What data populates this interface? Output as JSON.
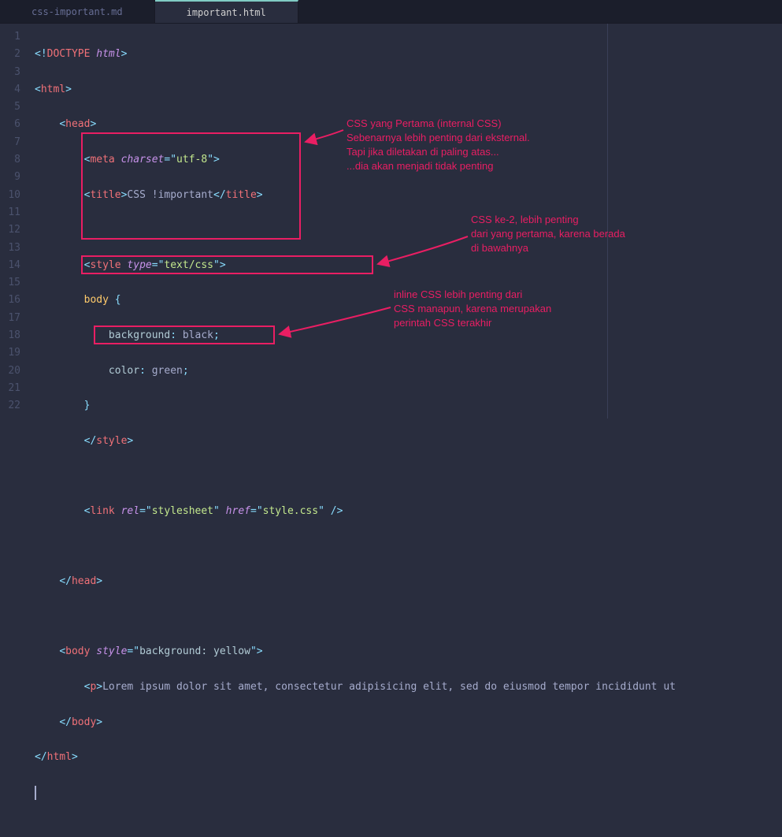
{
  "tabs": [
    {
      "label": "css-important.md",
      "active": false
    },
    {
      "label": "important.html",
      "active": true
    }
  ],
  "gutter": [
    "1",
    "2",
    "3",
    "4",
    "5",
    "6",
    "7",
    "8",
    "9",
    "10",
    "11",
    "12",
    "13",
    "14",
    "15",
    "16",
    "17",
    "18",
    "19",
    "20",
    "21",
    "22"
  ],
  "code": {
    "doctype_open": "<!",
    "doctype_name": "DOCTYPE",
    "doctype_attr": " html",
    "doctype_close": ">",
    "lt": "<",
    "gt": ">",
    "lts": "</",
    "sgt": "/>",
    "html": "html",
    "head": "head",
    "meta": "meta",
    "charset_attr": "charset",
    "eq": "=",
    "q": "\"",
    "utf8": "utf-8",
    "title": "title",
    "title_text": "CSS !important",
    "style": "style",
    "type_attr": "type",
    "textcss": "text/css",
    "body_sel": "body ",
    "brace_o": "{",
    "brace_c": "}",
    "bg_prop": "background",
    "colon": ": ",
    "black": "black",
    "semi": ";",
    "color_prop": "color",
    "green": "green",
    "link": "link",
    "rel_attr": "rel",
    "stylesheet": "stylesheet",
    "href_attr": "href",
    "stylecss": "style.css",
    "body_tag": "body",
    "style_attr": "style",
    "bg_yellow": "background: yellow",
    "p_tag": "p",
    "lorem": "Lorem ipsum dolor sit amet, consectetur adipisicing elit, sed do eiusmod tempor incididunt ut"
  },
  "annotations": {
    "a1": "CSS yang Pertama (internal CSS)\nSebenarnya lebih penting dari eksternal.\nTapi jika diletakan di paling atas...\n...dia akan menjadi tidak penting",
    "a2": "CSS ke-2, lebih penting\ndari yang pertama, karena berada\ndi bawahnya",
    "a3": "inline CSS lebih penting dari\nCSS manapun, karena merupakan\nperintah CSS terakhir"
  },
  "colors": {
    "annotation": "#e91e63"
  }
}
